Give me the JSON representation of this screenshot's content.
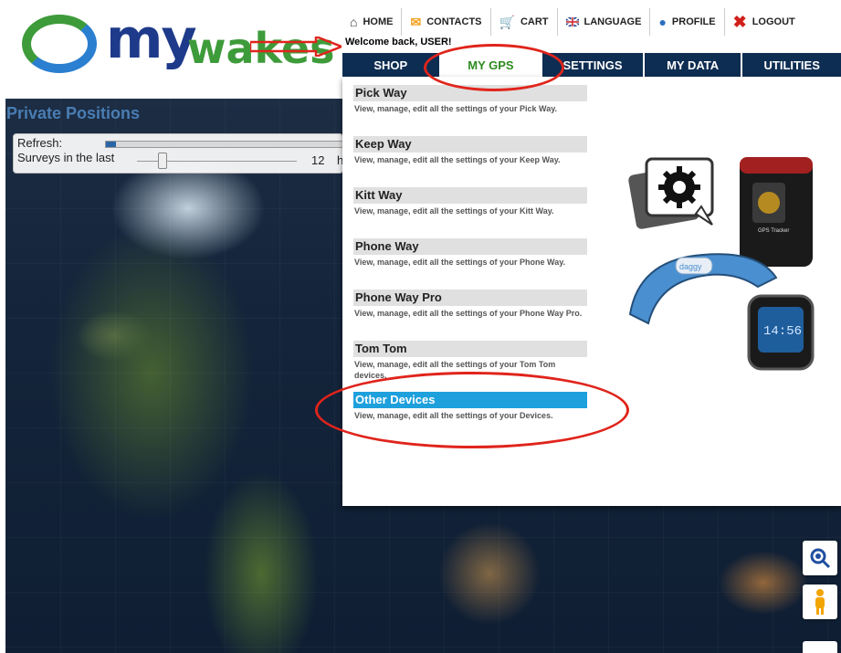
{
  "brand": {
    "logo_my": "my",
    "logo_wakes": "wakes"
  },
  "topnav": [
    {
      "label": "HOME",
      "icon": "home-icon"
    },
    {
      "label": "CONTACTS",
      "icon": "envelope-icon"
    },
    {
      "label": "CART",
      "icon": "cart-icon"
    },
    {
      "label": "LANGUAGE",
      "icon": "uk-flag-icon"
    },
    {
      "label": "PROFILE",
      "icon": "user-icon"
    },
    {
      "label": "LOGOUT",
      "icon": "close-icon"
    }
  ],
  "welcome": "Welcome back, USER!",
  "mainnav": [
    {
      "label": "SHOP"
    },
    {
      "label": "MY GPS",
      "active": true
    },
    {
      "label": "SETTINGS"
    },
    {
      "label": "MY DATA"
    },
    {
      "label": "UTILITIES"
    }
  ],
  "private_positions": {
    "title": "Private Positions",
    "refresh_label": "Refresh:",
    "refresh_level": 0.04,
    "surveys_label": "Surveys in the last",
    "surveys_value": "12",
    "surveys_unit": "h"
  },
  "menu": [
    {
      "title": "Pick Way",
      "desc": "View, manage, edit all the settings of your Pick Way."
    },
    {
      "title": "Keep Way",
      "desc": "View, manage, edit all the settings of your Keep Way."
    },
    {
      "title": "Kitt Way",
      "desc": "View, manage, edit all the settings of your Kitt Way."
    },
    {
      "title": "Phone Way",
      "desc": "View, manage, edit all the settings of your Phone Way."
    },
    {
      "title": "Phone Way Pro",
      "desc": "View, manage, edit all the settings of your Phone Way Pro."
    },
    {
      "title": "Tom Tom",
      "desc": "View, manage, edit all the settings of your Tom Tom devices."
    },
    {
      "title": "Other Devices",
      "desc": "View, manage, edit all the settings of your Devices.",
      "active": true
    }
  ],
  "devices_image": {
    "bracelet_label": "daggy",
    "gps_label": "GPS Tracker",
    "watch_time": "14:56"
  },
  "colors": {
    "nav_bg": "#0e2d52",
    "active_green": "#2e8b20",
    "highlight_blue": "#1ea0dc",
    "annotation_red": "#e0241b"
  }
}
